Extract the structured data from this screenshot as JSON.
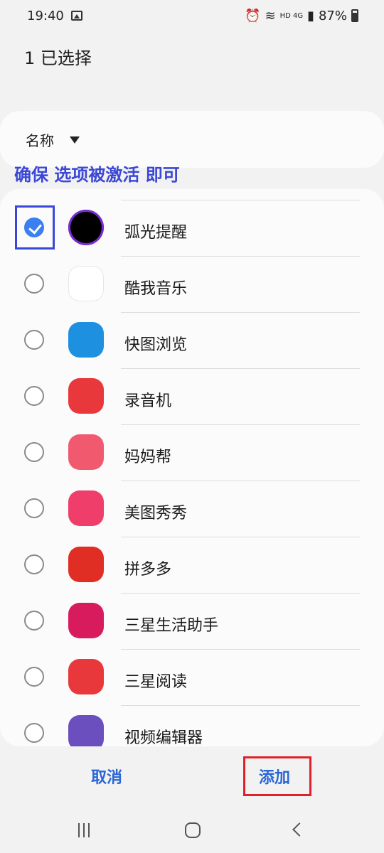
{
  "status_bar": {
    "time": "19:40",
    "battery": "87%",
    "network": "HD 4G"
  },
  "header": {
    "title": "1 已选择"
  },
  "sort": {
    "label": "名称"
  },
  "instruction": "确保 选项被激活 即可",
  "apps": [
    {
      "name": "弧光提醒",
      "checked": true,
      "icon": "arc-reminder-icon",
      "icon_color": "#000000"
    },
    {
      "name": "酷我音乐",
      "checked": false,
      "icon": "kuwo-music-icon",
      "icon_color": "#ffffff"
    },
    {
      "name": "快图浏览",
      "checked": false,
      "icon": "quickpic-icon",
      "icon_color": "#1e90e0"
    },
    {
      "name": "录音机",
      "checked": false,
      "icon": "recorder-icon",
      "icon_color": "#e8383c"
    },
    {
      "name": "妈妈帮",
      "checked": false,
      "icon": "mamabang-icon",
      "icon_color": "#f15a6e"
    },
    {
      "name": "美图秀秀",
      "checked": false,
      "icon": "meitu-icon",
      "icon_color": "#ef3e6a"
    },
    {
      "name": "拼多多",
      "checked": false,
      "icon": "pinduoduo-icon",
      "icon_color": "#e02e24"
    },
    {
      "name": "三星生活助手",
      "checked": false,
      "icon": "samsung-life-assistant-icon",
      "icon_color": "#d81b5c"
    },
    {
      "name": "三星阅读",
      "checked": false,
      "icon": "samsung-reading-icon",
      "icon_color": "#e8383c"
    },
    {
      "name": "视频编辑器",
      "checked": false,
      "icon": "video-editor-icon",
      "icon_color": "#6b4fbf"
    }
  ],
  "actions": {
    "cancel": "取消",
    "add": "添加"
  }
}
